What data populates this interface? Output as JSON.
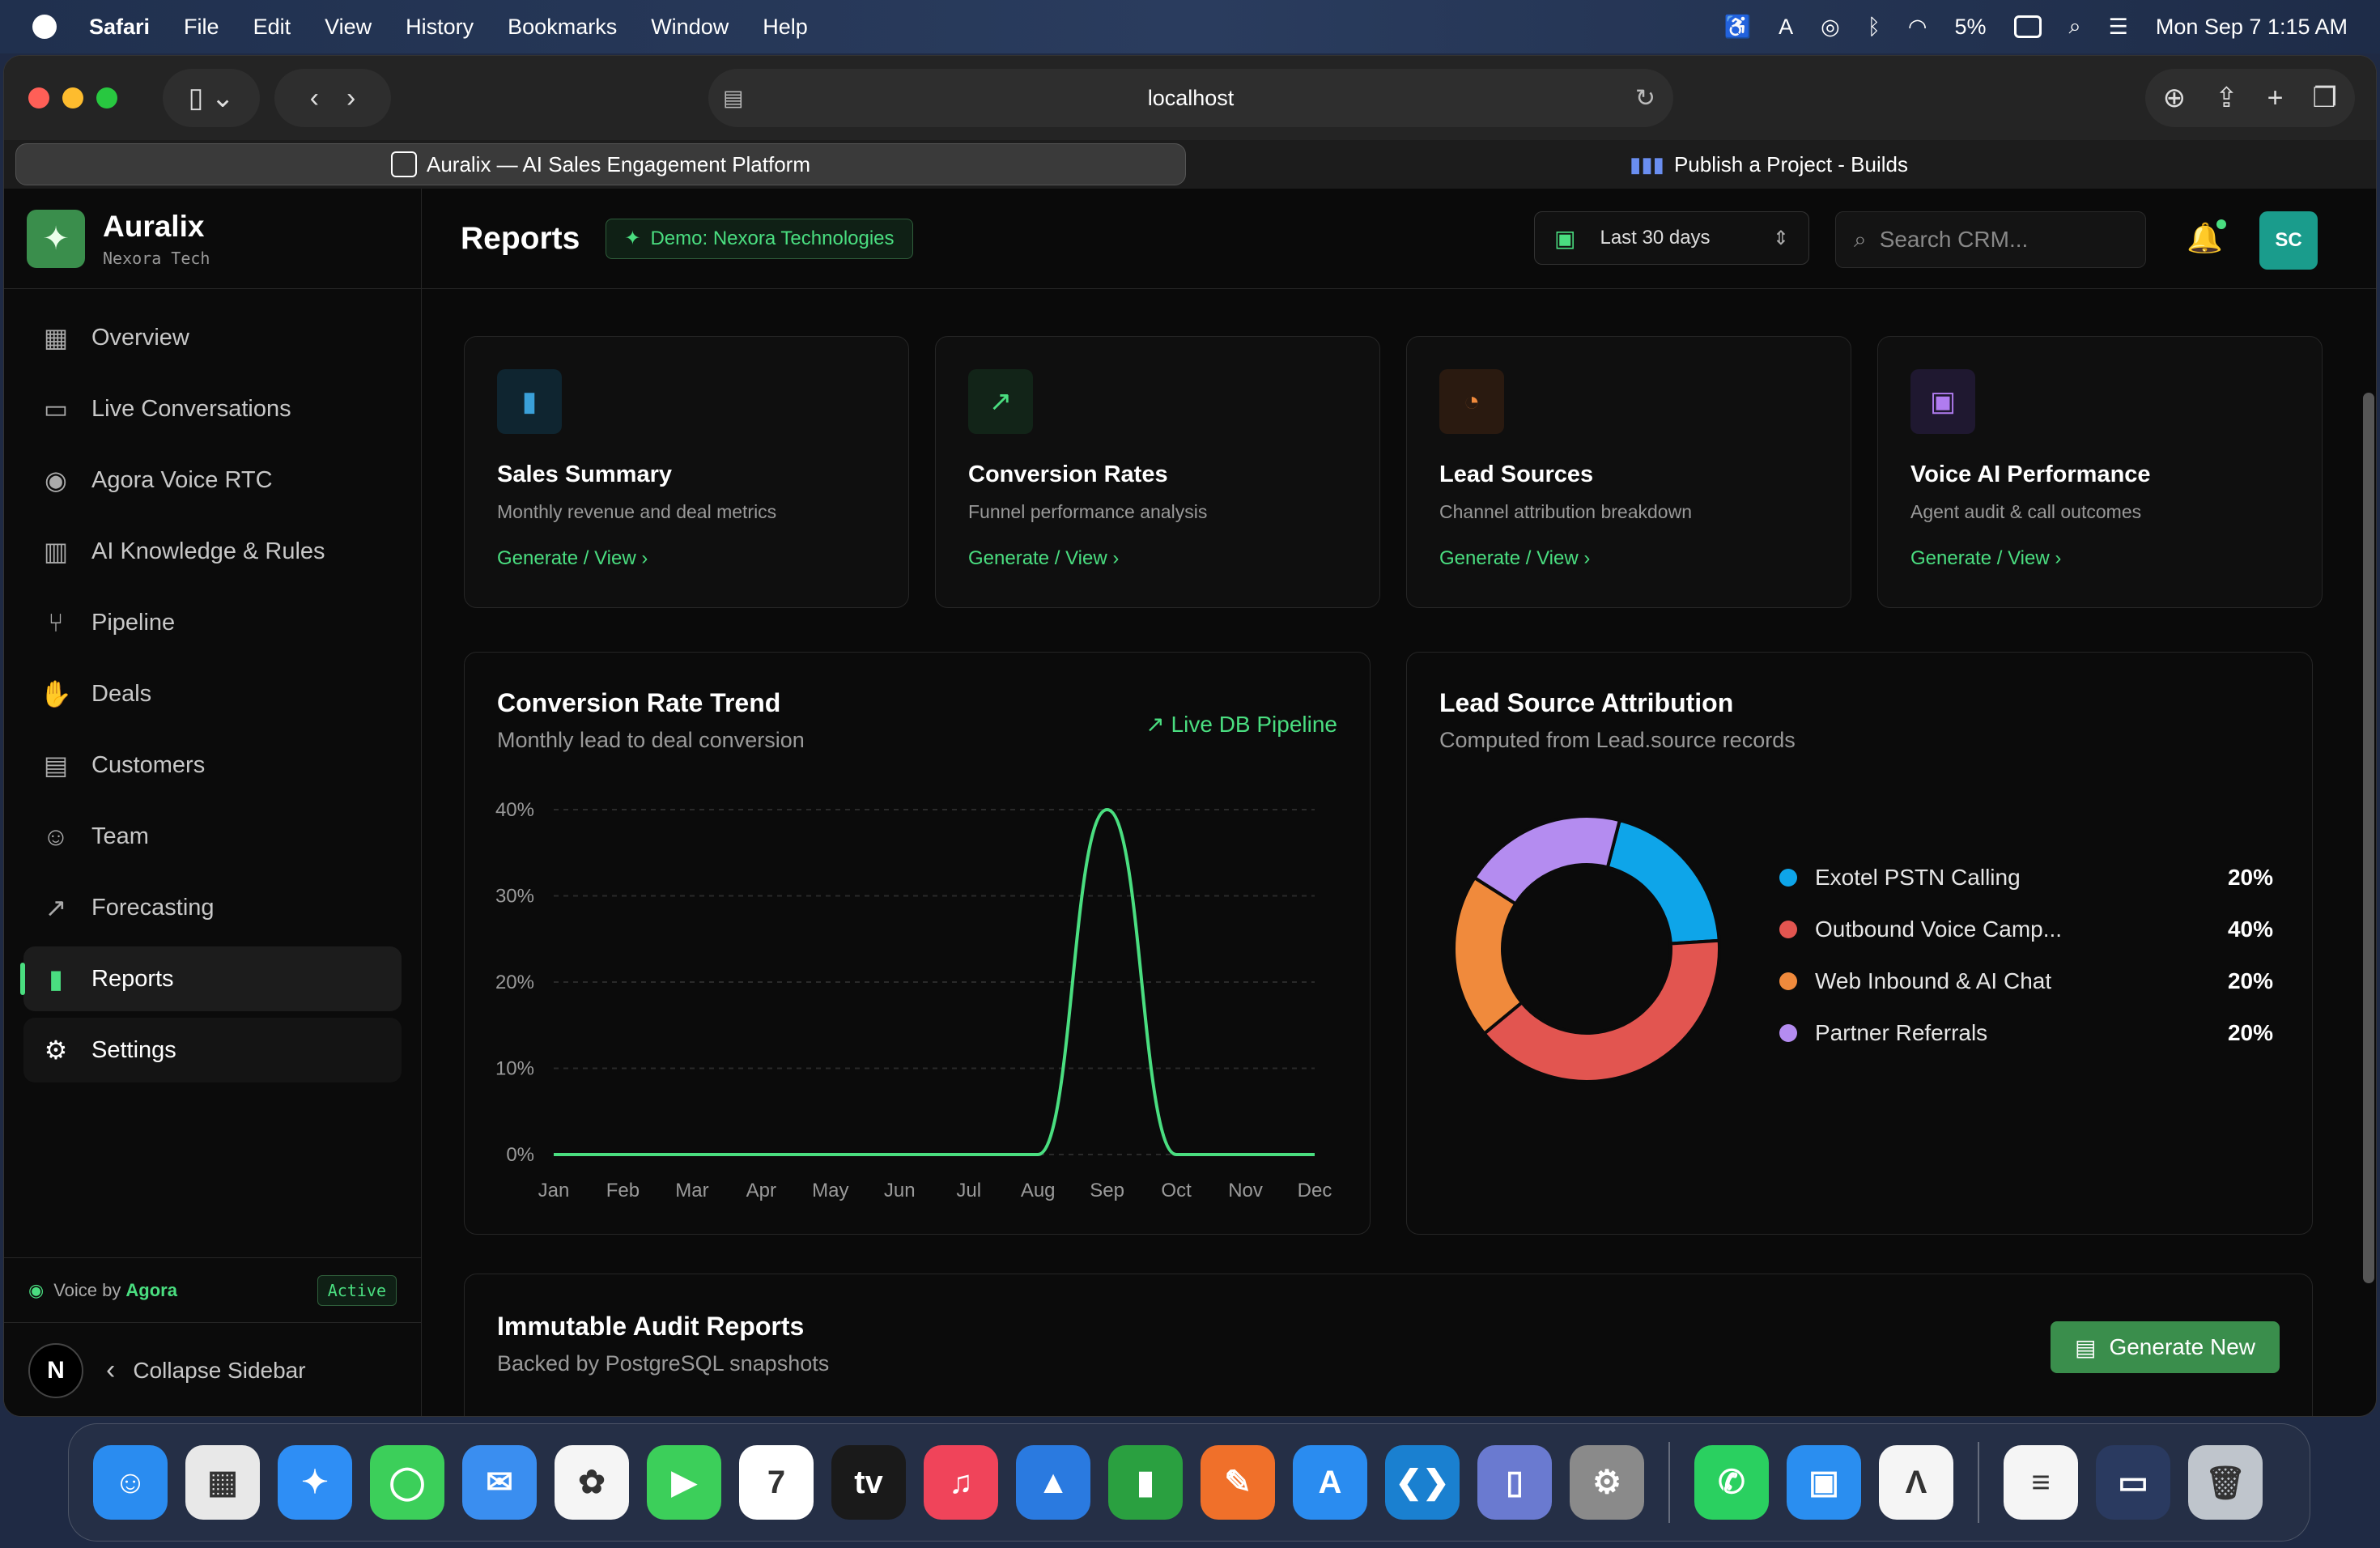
{
  "menubar": {
    "app": "Safari",
    "items": [
      "File",
      "Edit",
      "View",
      "History",
      "Bookmarks",
      "Window",
      "Help"
    ],
    "battery": "5%",
    "clock": "Mon Sep 7  1:15 AM"
  },
  "browser": {
    "url": "localhost",
    "tabs": [
      {
        "label": "Auralix — AI Sales Engagement Platform",
        "icon": "auralix-tab-icon"
      },
      {
        "label": "Publish a Project - Builds",
        "icon": "builds-tab-icon"
      }
    ]
  },
  "brand": {
    "name": "Auralix",
    "subtitle": "Nexora Tech"
  },
  "sidebar": {
    "items": [
      {
        "label": "Overview",
        "icon": "grid-icon"
      },
      {
        "label": "Live Conversations",
        "icon": "chat-icon"
      },
      {
        "label": "Agora Voice RTC",
        "icon": "broadcast-icon"
      },
      {
        "label": "AI Knowledge & Rules",
        "icon": "book-icon"
      },
      {
        "label": "Pipeline",
        "icon": "git-branch-icon"
      },
      {
        "label": "Deals",
        "icon": "handshake-icon"
      },
      {
        "label": "Customers",
        "icon": "building-icon"
      },
      {
        "label": "Team",
        "icon": "users-icon"
      },
      {
        "label": "Forecasting",
        "icon": "trend-icon"
      },
      {
        "label": "Reports",
        "icon": "bar-chart-icon"
      },
      {
        "label": "Settings",
        "icon": "gear-icon"
      }
    ],
    "voice_prefix": "Voice by",
    "voice_brand": "Agora",
    "voice_status": "Active",
    "collapse_label": "Collapse Sidebar",
    "avatar_letter": "N"
  },
  "header": {
    "title": "Reports",
    "demo_badge": "Demo: Nexora Technologies",
    "range": "Last 30 days",
    "search_placeholder": "Search CRM...",
    "avatar": "SC"
  },
  "cards": [
    {
      "title": "Sales Summary",
      "desc": "Monthly revenue and deal metrics",
      "link": "Generate / View",
      "icon": "bar-chart-icon",
      "color": "#3aa0d8",
      "bg": "#0f2530"
    },
    {
      "title": "Conversion Rates",
      "desc": "Funnel performance analysis",
      "link": "Generate / View",
      "icon": "trend-up-icon",
      "color": "#4ade80",
      "bg": "#122418"
    },
    {
      "title": "Lead Sources",
      "desc": "Channel attribution breakdown",
      "link": "Generate / View",
      "icon": "pie-chart-icon",
      "color": "#f08a3c",
      "bg": "#2a1a10"
    },
    {
      "title": "Voice AI Performance",
      "desc": "Agent audit & call outcomes",
      "link": "Generate / View",
      "icon": "calendar-icon",
      "color": "#b07cf0",
      "bg": "#1f1830"
    }
  ],
  "trend_panel": {
    "title": "Conversion Rate Trend",
    "subtitle": "Monthly lead to deal conversion",
    "badge": "Live DB Pipeline"
  },
  "attribution_panel": {
    "title": "Lead Source Attribution",
    "subtitle": "Computed from Lead.source records"
  },
  "audit_panel": {
    "title": "Immutable Audit Reports",
    "subtitle": "Backed by PostgreSQL snapshots",
    "button": "Generate New"
  },
  "chart_data": [
    {
      "type": "line",
      "x": [
        "Jan",
        "Feb",
        "Mar",
        "Apr",
        "May",
        "Jun",
        "Jul",
        "Aug",
        "Sep",
        "Oct",
        "Nov",
        "Dec"
      ],
      "series": [
        {
          "values": [
            0,
            0,
            0,
            0,
            0,
            0,
            0,
            0,
            40,
            0,
            0,
            0
          ],
          "color": "#4ade80"
        }
      ],
      "yticks": [
        "0%",
        "10%",
        "20%",
        "30%",
        "40%"
      ],
      "ylim": [
        0,
        40
      ],
      "grid": true
    },
    {
      "type": "pie",
      "donut": true,
      "labels": [
        "Exotel PSTN Calling",
        "Outbound Voice Camp...",
        "Web Inbound & AI Chat",
        "Partner Referrals"
      ],
      "values": [
        20,
        40,
        20,
        20
      ],
      "display": [
        "20%",
        "40%",
        "20%",
        "20%"
      ],
      "colors": [
        "#0ea5e9",
        "#e25550",
        "#f08a3c",
        "#b48cf0"
      ]
    }
  ],
  "dock": {
    "apps": [
      {
        "name": "finder-icon",
        "color": "#2a8cf0",
        "glyph": "☺"
      },
      {
        "name": "launchpad-icon",
        "color": "#e8e8e8",
        "glyph": "▦"
      },
      {
        "name": "safari-icon",
        "color": "#2e8ef5",
        "glyph": "✦"
      },
      {
        "name": "messages-icon",
        "color": "#3ccf5a",
        "glyph": "◯"
      },
      {
        "name": "mail-icon",
        "color": "#3a8ef0",
        "glyph": "✉"
      },
      {
        "name": "photos-icon",
        "color": "#f5f5f5",
        "glyph": "✿"
      },
      {
        "name": "facetime-icon",
        "color": "#3ccf5a",
        "glyph": "▶"
      },
      {
        "name": "calendar-icon",
        "color": "#ffffff",
        "glyph": "7"
      },
      {
        "name": "apple-tv-icon",
        "color": "#1a1a1a",
        "glyph": "tv"
      },
      {
        "name": "music-icon",
        "color": "#f0445a",
        "glyph": "♫"
      },
      {
        "name": "keynote-icon",
        "color": "#2a7ae0",
        "glyph": "▲"
      },
      {
        "name": "numbers-icon",
        "color": "#2aa040",
        "glyph": "▮"
      },
      {
        "name": "pages-icon",
        "color": "#f0702a",
        "glyph": "✎"
      },
      {
        "name": "app-store-icon",
        "color": "#2a8cf0",
        "glyph": "A"
      },
      {
        "name": "vscode-icon",
        "color": "#1a80d0",
        "glyph": "❮❯"
      },
      {
        "name": "simulator-icon",
        "color": "#6a7ad0",
        "glyph": "▯"
      },
      {
        "name": "system-settings-icon",
        "color": "#8a8a8a",
        "glyph": "⚙"
      },
      {
        "name": "whatsapp-icon",
        "color": "#2ad060",
        "glyph": "✆"
      },
      {
        "name": "docker-icon",
        "color": "#2a8ef0",
        "glyph": "▣"
      },
      {
        "name": "auralix-icon",
        "color": "#f5f5f5",
        "glyph": "Λ"
      },
      {
        "name": "document-icon",
        "color": "#f5f5f5",
        "glyph": "≡"
      },
      {
        "name": "screenshot-icon",
        "color": "#2a3a60",
        "glyph": "▭"
      },
      {
        "name": "trash-icon",
        "color": "#bfc5cc",
        "glyph": "🗑"
      }
    ]
  }
}
